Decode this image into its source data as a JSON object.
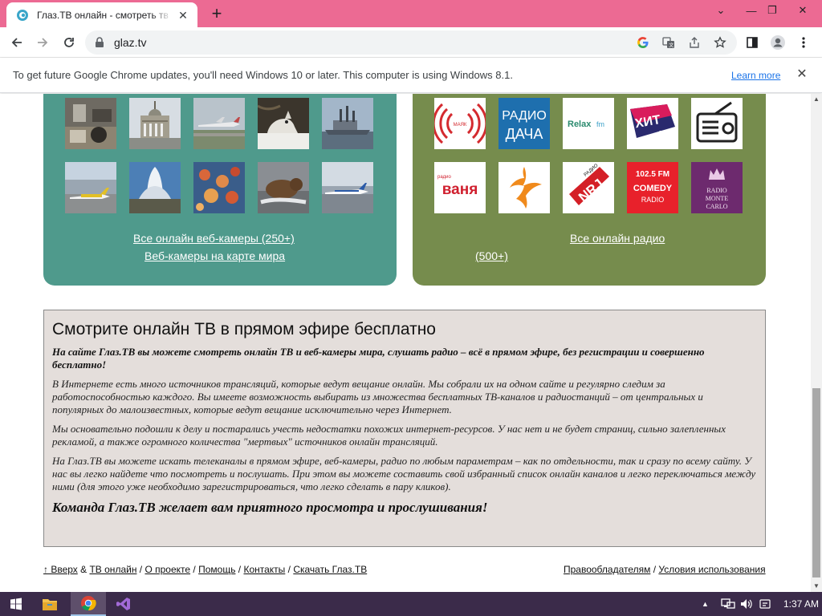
{
  "browser": {
    "tab_title": "Глаз.ТВ онлайн - смотреть тв и",
    "new_tab": "+",
    "tab_close": "✕",
    "url": "glaz.tv",
    "window_controls": {
      "chevron": "⌄",
      "minimize": "—",
      "restore": "❐",
      "close": "✕"
    }
  },
  "infobar": {
    "message": "To get future Google Chrome updates, you'll need Windows 10 or later. This computer is using Windows 8.1.",
    "learn_more": "Learn more",
    "close": "✕"
  },
  "colors": {
    "tab_strip": "#ec6a93",
    "cams_panel": "#4f9a8c",
    "radio_panel": "#768c4d",
    "about_bg": "#e4dedb",
    "taskbar": "#3b2b4a"
  },
  "cams_panel": {
    "thumbnails": [
      "webcam-thumbnail",
      "webcam-thumbnail",
      "webcam-thumbnail",
      "webcam-thumbnail",
      "webcam-thumbnail",
      "webcam-thumbnail",
      "webcam-thumbnail",
      "webcam-thumbnail",
      "webcam-thumbnail",
      "webcam-thumbnail"
    ],
    "link_all": "Все онлайн веб-камеры (250+)",
    "link_map": "Веб-камеры на карте мира"
  },
  "radio_panel": {
    "logos": {
      "radio_dacha_line1": "РАДИО",
      "radio_dacha_line2": "ДАЧА",
      "relax": "Relax",
      "relax_fm": "fm",
      "hit": "ХИТ",
      "hit_fm": "FM",
      "mayak": "МАЯК",
      "vanya": "ваня",
      "vanya_small": "радио",
      "nrj": "NRJ",
      "nrj_small": "РАДИО",
      "comedy_freq": "102.5 FM",
      "comedy": "COMEDY",
      "comedy_radio": "RADIO",
      "monte_1": "RADIO",
      "monte_2": "MONTE",
      "monte_3": "CARLO"
    },
    "link_all": "Все онлайн радио",
    "link_count": "(500+)"
  },
  "about": {
    "heading": "Смотрите онлайн ТВ в прямом эфире бесплатно",
    "lead": "На сайте Глаз.ТВ вы можете смотреть онлайн ТВ и веб-камеры мира, слушать радио – всё в прямом эфире, без регистрации и совершенно бесплатно!",
    "p1": "В Интернете есть много источников трансляций, которые ведут вещание онлайн. Мы собрали их на одном сайте и регулярно следим за работоспособностью каждого. Вы имеете возможность выбирать из множества бесплатных ТВ-каналов и радиостанций – от центральных и популярных до малоизвестных, которые ведут вещание исключительно через Интернет.",
    "p2": "Мы основательно подошли к делу и постарались учесть недостатки похожих интернет-ресурсов. У нас нет и не будет страниц, сильно залепленных рекламой, а также огромного количества \"мертвых\" источников онлайн трансляций.",
    "p3": "На Глаз.ТВ вы можете искать телеканалы в прямом эфире, веб-камеры, радио по любым параметрам – как по отдельности, так и сразу по всему сайту. У нас вы легко найдете что посмотреть и послушать. При этом вы можете составить свой избранный список онлайн каналов и легко переключаться между ними (для этого уже необходимо зарегистрироваться, что легко сделать в пару кликов).",
    "sign": "Команда Глаз.ТВ желает вам приятного просмотра и прослушивания!"
  },
  "footer": {
    "up": "↑ Вверх",
    "amp": " & ",
    "tv_online": "ТВ онлайн",
    "sep": " / ",
    "about": "О проекте",
    "help": "Помощь",
    "contacts": "Контакты",
    "download": "Скачать Глаз.ТВ",
    "rights": "Правообладателям",
    "terms": "Условия использования"
  },
  "taskbar": {
    "time": "1:37 AM",
    "apps": [
      "windows-start-icon",
      "file-explorer-icon",
      "chrome-icon",
      "visual-studio-icon"
    ]
  }
}
